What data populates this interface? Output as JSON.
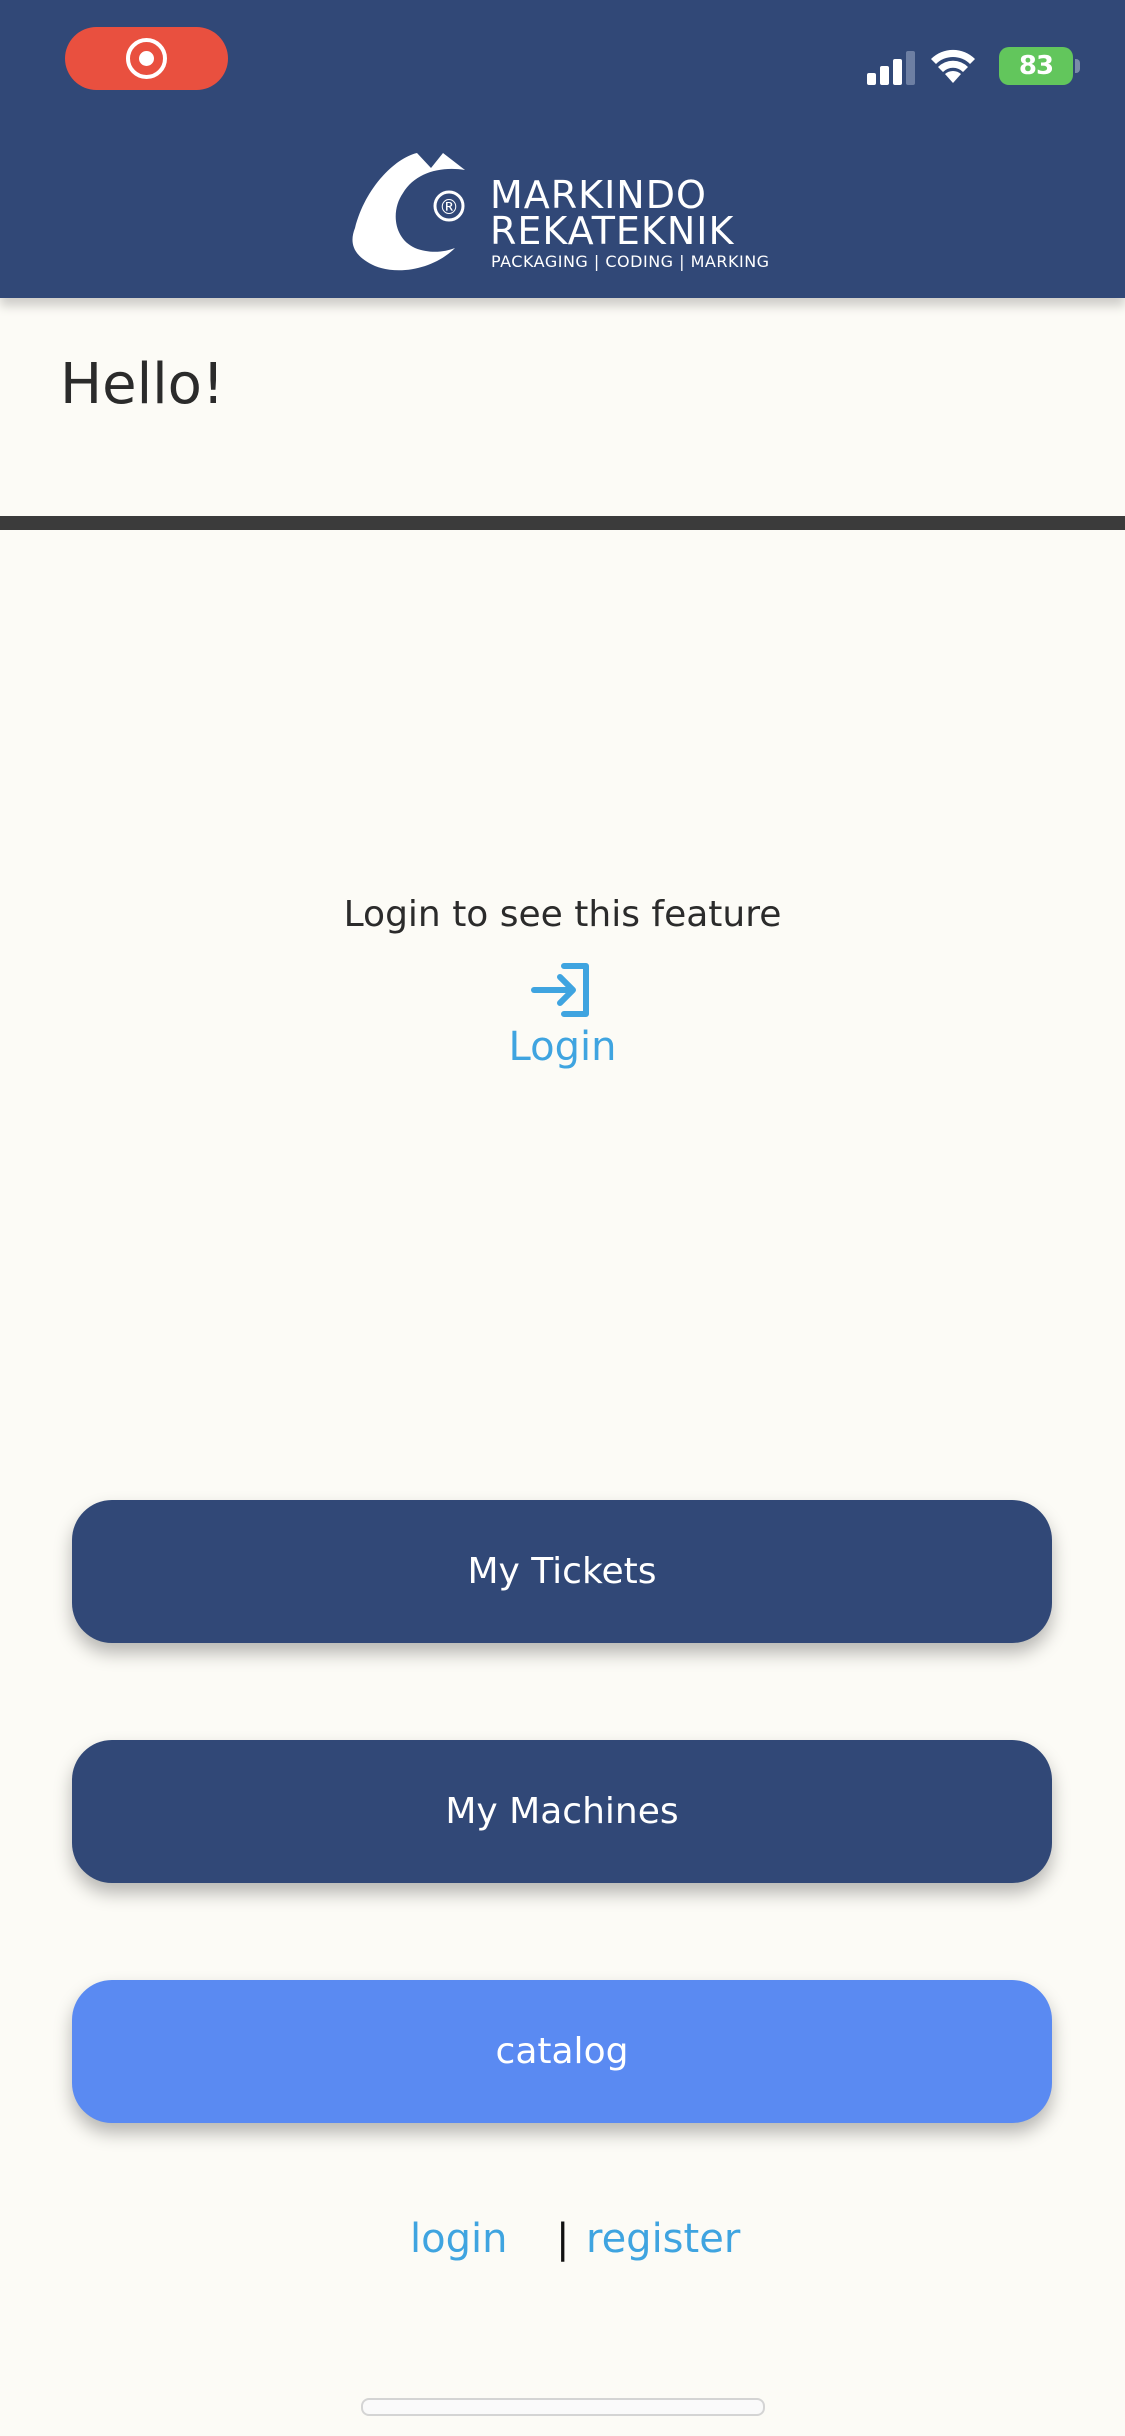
{
  "status_bar": {
    "battery": "83",
    "icons": [
      "screen-record-icon",
      "signal-icon",
      "wifi-icon",
      "battery-icon"
    ]
  },
  "header": {
    "brand_line1": "MARKINDO",
    "brand_line2": "REKATEKNIK",
    "brand_tagline": "PACKAGING | CODING | MARKING",
    "registered_mark": "®"
  },
  "greeting": "Hello!",
  "login_notice": {
    "message": "Login to see this feature",
    "link_label": "Login",
    "icon": "login-arrow-icon"
  },
  "buttons": {
    "tickets": "My Tickets",
    "machines": "My Machines",
    "catalog": "catalog"
  },
  "auth": {
    "login": "login",
    "separator": "|",
    "register": "register"
  },
  "colors": {
    "header_bg": "#314877",
    "button_dark": "#314877",
    "button_catalog": "#5a8af2",
    "link": "#3fa4e0",
    "record_pill": "#e9503f",
    "battery": "#62c65c",
    "page_bg": "#fcfbf6"
  }
}
